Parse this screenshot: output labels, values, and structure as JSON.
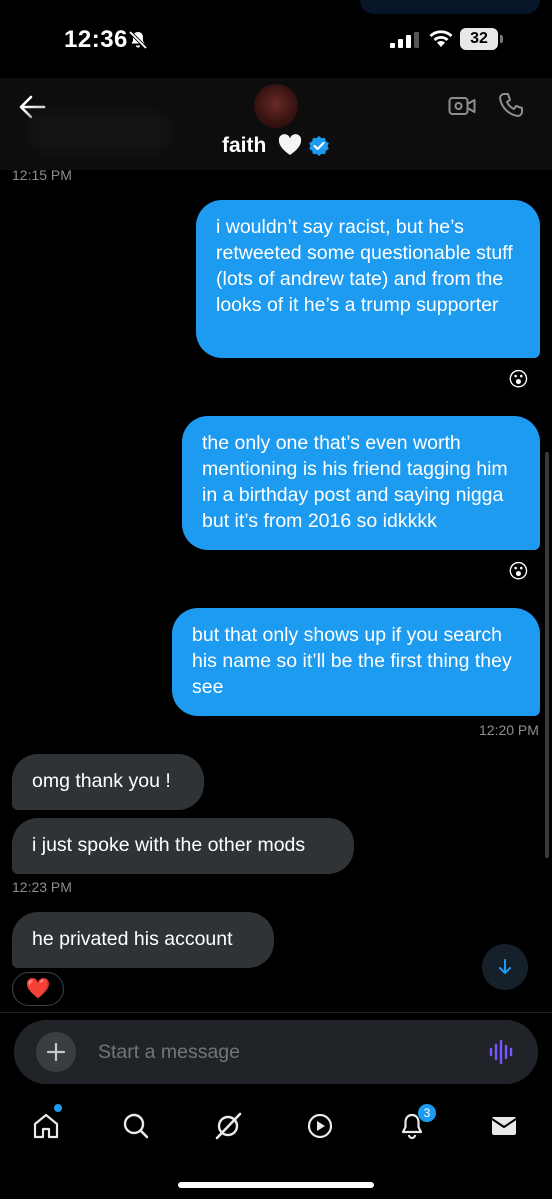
{
  "status_bar": {
    "time": "12:36",
    "battery": "32"
  },
  "header": {
    "name": "faith",
    "heart": "🤍"
  },
  "messages": [
    {
      "timestamp": "12:15 PM"
    },
    {
      "text": "i wouldn’t say racist, but he’s retweeted some questionable stuff (lots of andrew tate) and from the looks of it he’s a trump supporter",
      "reaction": "😮"
    },
    {
      "text": "the only one that’s even worth mentioning is his friend tagging him in a birthday post and saying nigga but it’s from 2016 so idkkkk",
      "reaction": "😮"
    },
    {
      "text": "but that only shows up if you search his name so it’ll be the first thing they see",
      "timestamp": "12:20 PM"
    },
    {
      "text": "omg thank you !"
    },
    {
      "text": "i just spoke with the other mods",
      "timestamp": "12:23 PM"
    },
    {
      "text": "he privated his account",
      "reaction": "❤️"
    }
  ],
  "composer": {
    "placeholder": "Start a message"
  },
  "tabbar": {
    "notifications_count": "3"
  },
  "colors": {
    "accent": "#1d9bf0",
    "incoming_bubble": "#2f3336",
    "background": "#000000",
    "voice_icon": "#7856ff"
  },
  "icons": [
    "back-arrow-icon",
    "video-call-icon",
    "phone-icon",
    "verified-badge-icon",
    "plus-icon",
    "voice-message-icon",
    "home-icon",
    "search-icon",
    "grok-icon",
    "video-tab-icon",
    "notifications-icon",
    "messages-icon",
    "scroll-down-icon"
  ]
}
